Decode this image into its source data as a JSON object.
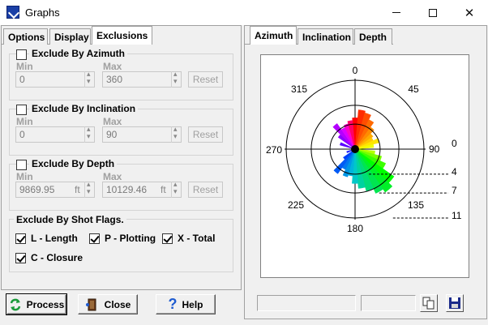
{
  "window": {
    "title": "Graphs"
  },
  "left_tabs": [
    {
      "label": "Options",
      "active": false
    },
    {
      "label": "Display",
      "active": false
    },
    {
      "label": "Exclusions",
      "active": true
    }
  ],
  "right_tabs": [
    {
      "label": "Azimuth",
      "active": true
    },
    {
      "label": "Inclination",
      "active": false
    },
    {
      "label": "Depth",
      "active": false
    }
  ],
  "exclusions": {
    "azimuth": {
      "label": "Exclude By Azimuth",
      "checked": false,
      "min_label": "Min",
      "max_label": "Max",
      "min": "0",
      "max": "360",
      "reset": "Reset"
    },
    "inclination": {
      "label": "Exclude By Inclination",
      "checked": false,
      "min_label": "Min",
      "max_label": "Max",
      "min": "0",
      "max": "90",
      "reset": "Reset"
    },
    "depth": {
      "label": "Exclude By Depth",
      "checked": false,
      "min_label": "Min",
      "max_label": "Max",
      "min": "9869.95",
      "max": "10129.46",
      "unit": "ft",
      "reset": "Reset"
    },
    "shot_flags": {
      "label": "Exclude By Shot Flags.",
      "flags": [
        {
          "label": "L - Length",
          "checked": true
        },
        {
          "label": "P - Plotting",
          "checked": true
        },
        {
          "label": "X - Total",
          "checked": true
        },
        {
          "label": "C - Closure",
          "checked": true
        }
      ]
    }
  },
  "buttons": {
    "process": "Process",
    "close": "Close",
    "help": "Help"
  },
  "colors": {
    "accent": "#1a3fa6",
    "process_icon": "#1a9a3a",
    "help_icon": "#1e5bd0"
  },
  "chart_data": {
    "type": "rose",
    "direction_labels": [
      "0",
      "45",
      "90",
      "135",
      "180",
      "225",
      "270",
      "315"
    ],
    "radial_labels": [
      "0",
      "4",
      "7",
      "11"
    ],
    "radial_max": 11,
    "bin_width_deg": 10,
    "bins": [
      {
        "azimuth": 0,
        "count": 5.0,
        "color": "#ff0000"
      },
      {
        "azimuth": 10,
        "count": 6.3,
        "color": "#ff2b00"
      },
      {
        "azimuth": 20,
        "count": 6.0,
        "color": "#ff4d00"
      },
      {
        "azimuth": 30,
        "count": 5.2,
        "color": "#ff6a00"
      },
      {
        "azimuth": 40,
        "count": 4.3,
        "color": "#ff8c00"
      },
      {
        "azimuth": 50,
        "count": 3.5,
        "color": "#ffaa00"
      },
      {
        "azimuth": 60,
        "count": 3.2,
        "color": "#ffc800"
      },
      {
        "azimuth": 70,
        "count": 4.0,
        "color": "#ffe600"
      },
      {
        "azimuth": 80,
        "count": 3.0,
        "color": "#f0ff00"
      },
      {
        "azimuth": 100,
        "count": 3.2,
        "color": "#b4ff00"
      },
      {
        "azimuth": 110,
        "count": 4.4,
        "color": "#78ff00"
      },
      {
        "azimuth": 120,
        "count": 5.4,
        "color": "#3cff00"
      },
      {
        "azimuth": 130,
        "count": 7.6,
        "color": "#00ff00"
      },
      {
        "azimuth": 140,
        "count": 8.4,
        "color": "#00f028"
      },
      {
        "azimuth": 150,
        "count": 7.8,
        "color": "#00e650"
      },
      {
        "azimuth": 160,
        "count": 7.0,
        "color": "#00dc78"
      },
      {
        "azimuth": 170,
        "count": 6.3,
        "color": "#00d2a0"
      },
      {
        "azimuth": 180,
        "count": 5.5,
        "color": "#00c8c8"
      },
      {
        "azimuth": 190,
        "count": 4.3,
        "color": "#00b4dc"
      },
      {
        "azimuth": 200,
        "count": 4.6,
        "color": "#0096e6"
      },
      {
        "azimuth": 210,
        "count": 3.6,
        "color": "#0078f0"
      },
      {
        "azimuth": 220,
        "count": 4.8,
        "color": "#005af5"
      },
      {
        "azimuth": 230,
        "count": 2.3,
        "color": "#003cfa"
      },
      {
        "azimuth": 250,
        "count": 1.4,
        "color": "#1e1efa"
      },
      {
        "azimuth": 290,
        "count": 2.5,
        "color": "#5a00ff"
      },
      {
        "azimuth": 310,
        "count": 3.3,
        "color": "#8c00ff"
      },
      {
        "azimuth": 320,
        "count": 5.0,
        "color": "#b400ff"
      },
      {
        "azimuth": 330,
        "count": 3.8,
        "color": "#dc00ff"
      },
      {
        "azimuth": 340,
        "count": 4.2,
        "color": "#ff00c8"
      },
      {
        "azimuth": 350,
        "count": 4.6,
        "color": "#ff0064"
      }
    ]
  }
}
